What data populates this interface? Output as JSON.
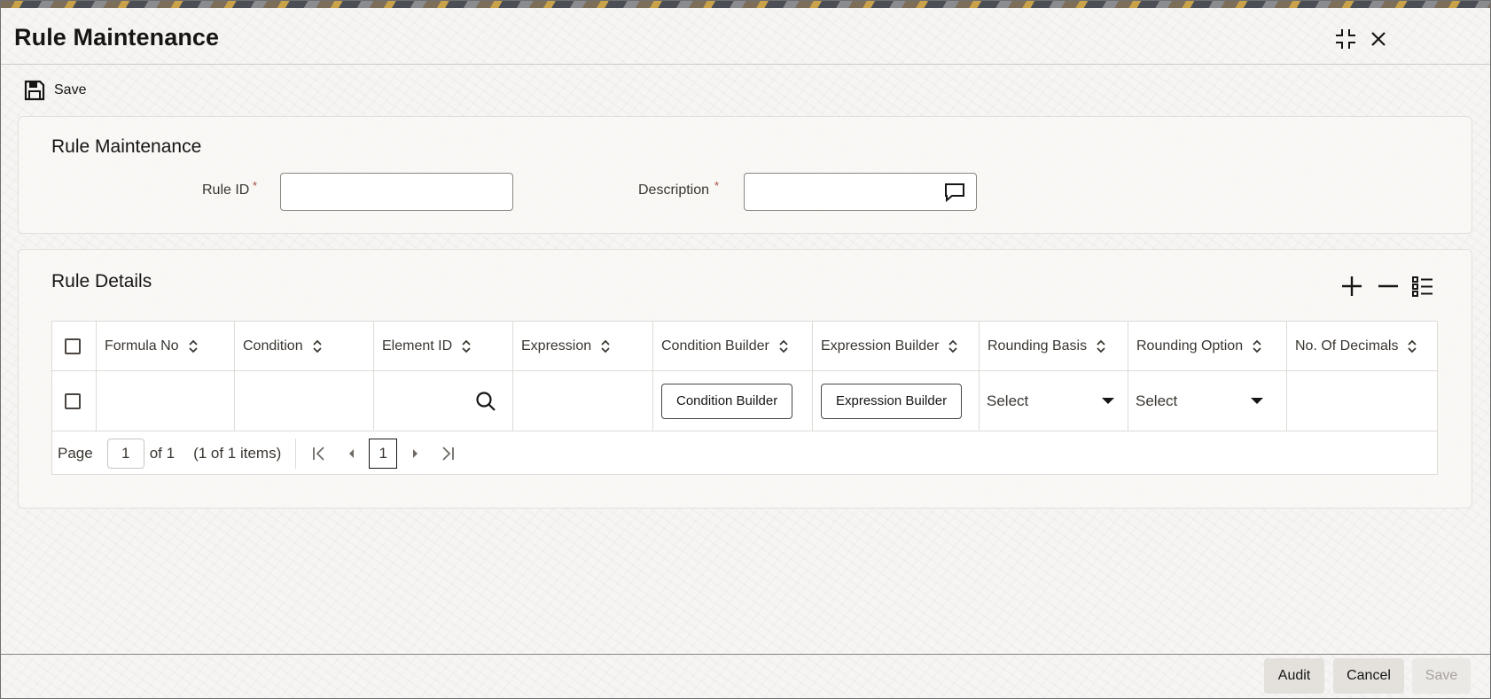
{
  "window": {
    "title": "Rule Maintenance"
  },
  "toolbar": {
    "save_label": "Save"
  },
  "header_panel": {
    "title": "Rule Maintenance",
    "rule_id_label": "Rule ID",
    "rule_id_value": "",
    "description_label": "Description",
    "description_value": "",
    "required_mark": "*"
  },
  "details_panel": {
    "title": "Rule Details",
    "columns": [
      "Formula No",
      "Condition",
      "Element ID",
      "Expression",
      "Condition Builder",
      "Expression Builder",
      "Rounding Basis",
      "Rounding Option",
      "No. Of Decimals"
    ],
    "row": {
      "formula_no": "",
      "condition": "",
      "expression": "",
      "condition_builder_button": "Condition Builder",
      "expression_builder_button": "Expression Builder",
      "rounding_basis": "Select",
      "rounding_option": "Select",
      "no_of_decimals": ""
    },
    "pager": {
      "page_label": "Page",
      "page_value": "1",
      "of_label": "of 1",
      "items_label": "(1 of 1 items)",
      "current_page": "1"
    }
  },
  "footer": {
    "audit_label": "Audit",
    "cancel_label": "Cancel",
    "save_label": "Save"
  }
}
